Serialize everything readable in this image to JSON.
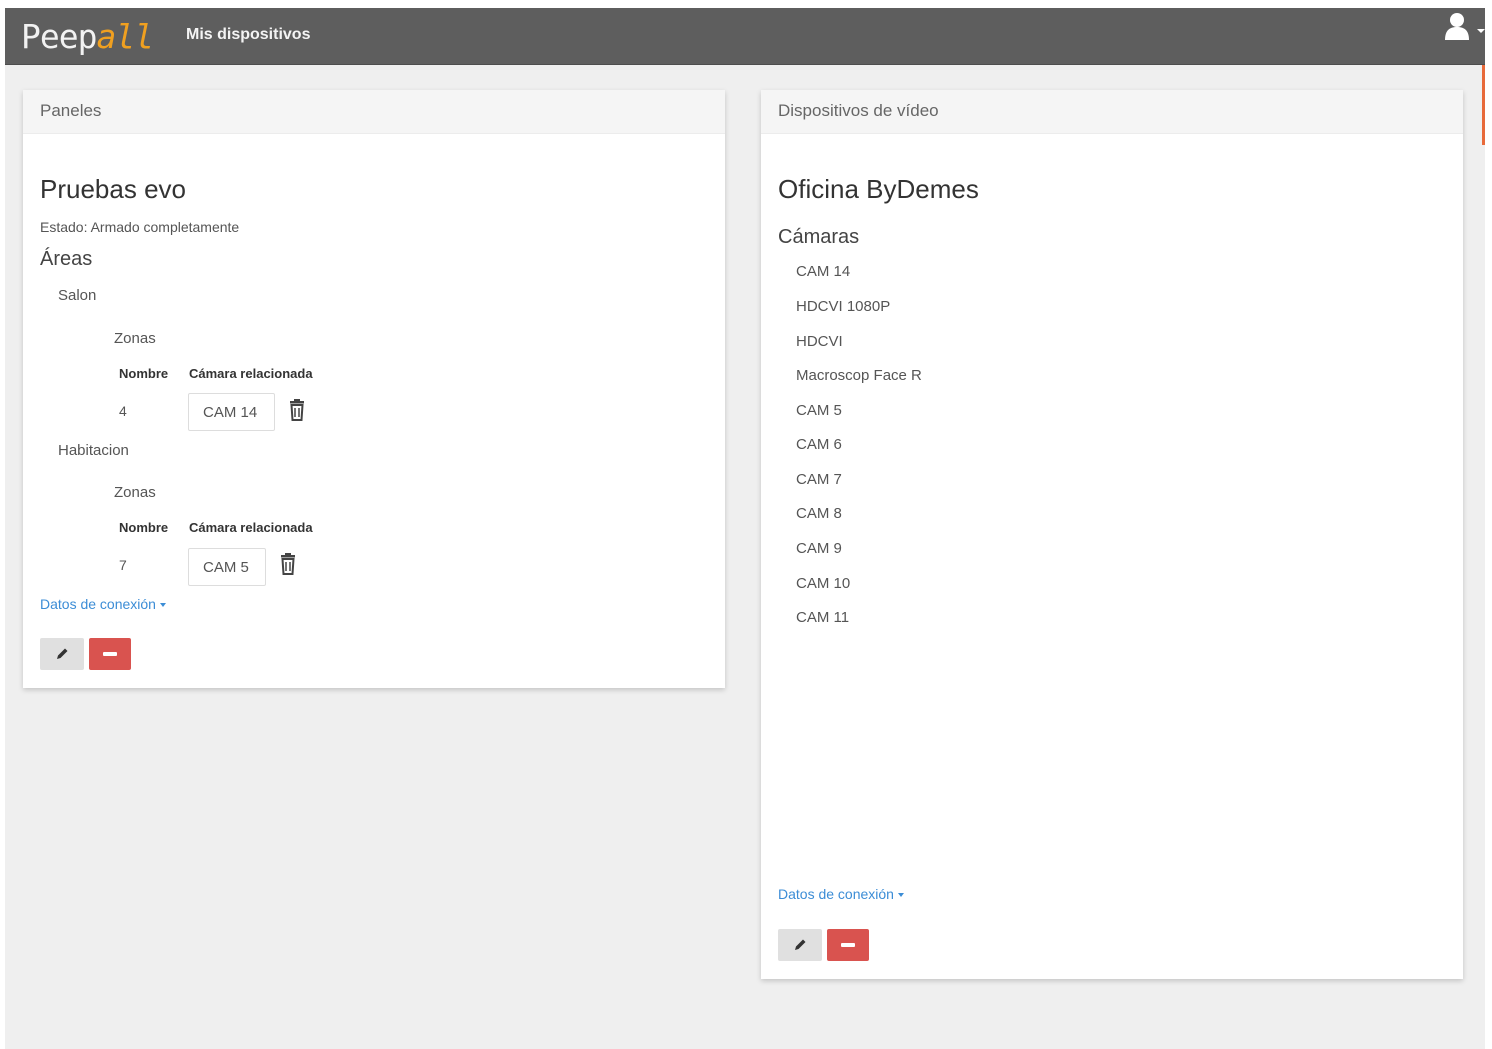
{
  "navbar": {
    "brand_main": "Peep",
    "brand_accent": "all",
    "nav_link": "Mis dispositivos",
    "user_icon": "user-icon"
  },
  "left_panel": {
    "heading": "Paneles",
    "title": "Pruebas evo",
    "status": "Estado: Armado completamente",
    "areas_title": "Áreas",
    "areas": [
      {
        "name": "Salon",
        "zones_label": "Zonas",
        "col_name": "Nombre",
        "col_camera": "Cámara relacionada",
        "zone_name": "4",
        "zone_camera": "CAM 14"
      },
      {
        "name": "Habitacion",
        "zones_label": "Zonas",
        "col_name": "Nombre",
        "col_camera": "Cámara relacionada",
        "zone_name": "7",
        "zone_camera": "CAM 5"
      }
    ],
    "connection_link": "Datos de conexión",
    "edit_icon": "pencil-icon",
    "remove_icon": "minus-icon"
  },
  "right_panel": {
    "heading": "Dispositivos de vídeo",
    "title": "Oficina ByDemes",
    "cameras_title": "Cámaras",
    "cameras": [
      "CAM 14",
      "HDCVI 1080P",
      "HDCVI",
      "Macroscop Face R",
      "CAM 5",
      "CAM 6",
      "CAM 7",
      "CAM 8",
      "CAM 9",
      "CAM 10",
      "CAM 11"
    ],
    "connection_link": "Datos de conexión",
    "edit_icon": "pencil-icon",
    "remove_icon": "minus-icon"
  },
  "colors": {
    "navbar": "#5e5e5e",
    "brand_accent": "#f0a020",
    "link": "#3c8dd6",
    "danger": "#d9534f",
    "background": "#efefef"
  }
}
